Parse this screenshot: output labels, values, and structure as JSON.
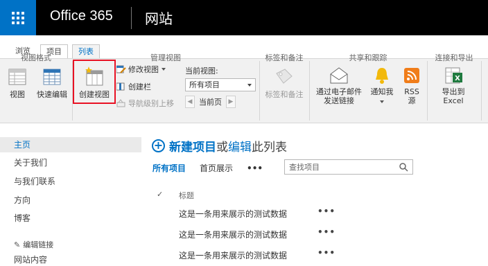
{
  "suite": {
    "brand": "Office 365",
    "site": "网站"
  },
  "tabs": {
    "browse": "浏览",
    "items": "项目",
    "list": "列表"
  },
  "ribbon": {
    "view": "视图",
    "quick_edit": "快速编辑",
    "create_view": "创建视图",
    "modify_view": "修改视图",
    "create_column": "创建栏",
    "navigate_up": "导航级别上移",
    "current_view_label": "当前视图:",
    "current_view_value": "所有项目",
    "current_page": "当前页",
    "tags_notes": "标签和备注",
    "email_link_line1": "通过电子邮件",
    "email_link_line2": "发送链接",
    "alert_me": "通知我",
    "rss_line1": "RSS",
    "rss_line2": "源",
    "export_line1": "导出到",
    "export_line2": "Excel",
    "groups": {
      "view_format": "视图格式",
      "manage_views": "管理视图",
      "tags_notes": "标签和备注",
      "share_track": "共享和跟踪",
      "connect_export": "连接和导出"
    }
  },
  "leftnav": {
    "items": [
      {
        "label": "主页",
        "active": true
      },
      {
        "label": "关于我们"
      },
      {
        "label": "与我们联系"
      },
      {
        "label": "方向"
      },
      {
        "label": "博客"
      }
    ],
    "edit_links": "编辑链接",
    "site_contents": "网站内容"
  },
  "main": {
    "new_item": "新建项目",
    "or": "或",
    "edit": "编辑",
    "this_list": "此列表",
    "views": {
      "all_items": "所有项目",
      "home_display": "首页展示",
      "more": "•••"
    },
    "search_placeholder": "查找项目",
    "col_title": "标题",
    "rows": [
      "这是一条用来展示的测试数据",
      "这是一条用来展示的测试数据",
      "这是一条用来展示的测试数据"
    ],
    "row_menu": "•••"
  },
  "colors": {
    "accent": "#0072c6",
    "highlight": "#e81123",
    "suitebar": "#000000"
  }
}
